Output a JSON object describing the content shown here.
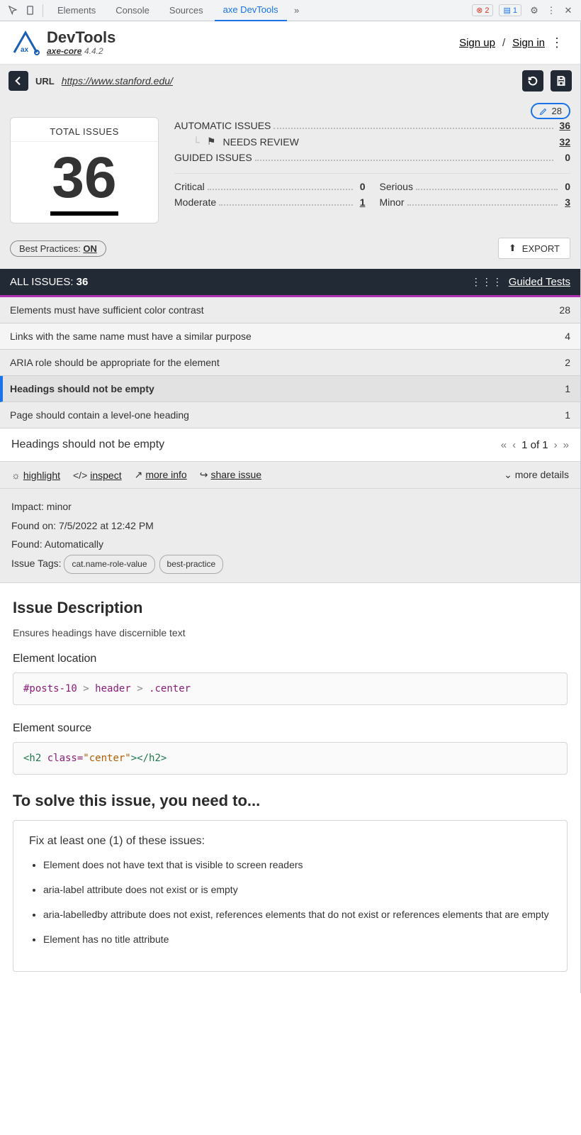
{
  "devtools": {
    "tabs": [
      "Elements",
      "Console",
      "Sources",
      "axe DevTools"
    ],
    "err_count": "2",
    "msg_count": "1"
  },
  "header": {
    "title": "DevTools",
    "sub": "axe-core",
    "ver": "4.4.2",
    "signup": "Sign up",
    "signin": "Sign in"
  },
  "urlbar": {
    "label": "URL",
    "url": "https://www.stanford.edu/"
  },
  "summary": {
    "pill_count": "28",
    "total_label": "TOTAL ISSUES",
    "total": "36",
    "auto_label": "AUTOMATIC ISSUES",
    "auto": "36",
    "needs_review_label": "NEEDS REVIEW",
    "needs_review": "32",
    "guided_label": "GUIDED ISSUES",
    "guided": "0",
    "sev": {
      "critical_l": "Critical",
      "critical_v": "0",
      "serious_l": "Serious",
      "serious_v": "0",
      "moderate_l": "Moderate",
      "moderate_v": "1",
      "minor_l": "Minor",
      "minor_v": "3"
    },
    "bp_label": "Best Practices:",
    "bp_state": "ON",
    "export": "EXPORT"
  },
  "darkbar": {
    "all_label": "ALL ISSUES:",
    "all_count": "36",
    "guided_link": "Guided Tests"
  },
  "issues": [
    {
      "t": "Elements must have sufficient color contrast",
      "c": "28"
    },
    {
      "t": "Links with the same name must have a similar purpose",
      "c": "4"
    },
    {
      "t": "ARIA role should be appropriate for the element",
      "c": "2"
    },
    {
      "t": "Headings should not be empty",
      "c": "1"
    },
    {
      "t": "Page should contain a level-one heading",
      "c": "1"
    }
  ],
  "selected": {
    "title": "Headings should not be empty",
    "pager": "1 of 1"
  },
  "actbar": {
    "highlight": "highlight",
    "inspect": "inspect",
    "more_info": "more info",
    "share": "share issue",
    "more_details": "more details"
  },
  "meta": {
    "impact_k": "Impact:",
    "impact_v": "minor",
    "found_on_k": "Found on:",
    "found_on_v": "7/5/2022 at 12:42 PM",
    "found_k": "Found:",
    "found_v": "Automatically",
    "tags_k": "Issue Tags:",
    "tags": [
      "cat.name-role-value",
      "best-practice"
    ]
  },
  "desc": {
    "h": "Issue Description",
    "p": "Ensures headings have discernible text",
    "loc_h": "Element location",
    "loc_code": {
      "id": "#posts-10",
      "g1": ">",
      "el": "header",
      "g2": ">",
      "cls": ".center"
    },
    "src_h": "Element source",
    "src_code": {
      "open": "<h2 ",
      "attr": "class=",
      "str": "\"center\"",
      "mid": "></",
      "close": "h2>"
    },
    "solve_h": "To solve this issue, you need to...",
    "fix_h": "Fix at least one (1) of these issues:",
    "fixes": [
      "Element does not have text that is visible to screen readers",
      "aria-label attribute does not exist or is empty",
      "aria-labelledby attribute does not exist, references elements that do not exist or references elements that are empty",
      "Element has no title attribute"
    ]
  }
}
